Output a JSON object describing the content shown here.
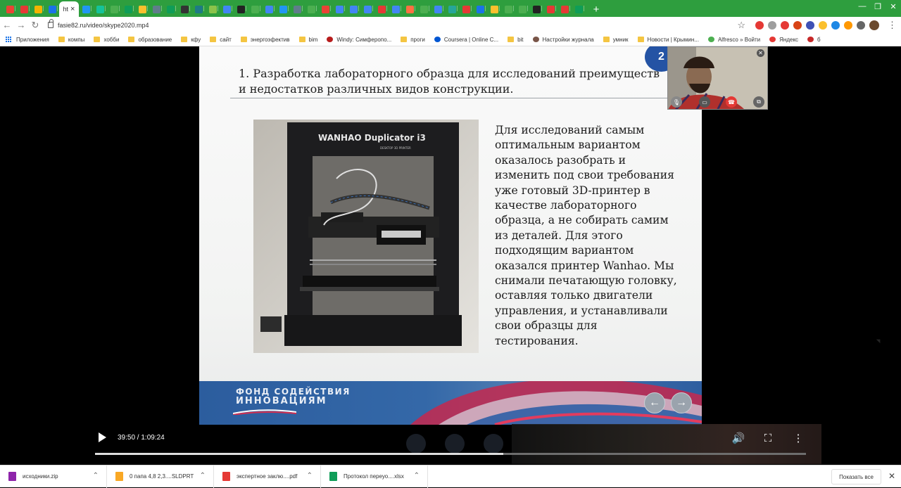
{
  "tabs": [
    {
      "icon": "gmail-icon",
      "color": "#ea4335"
    },
    {
      "icon": "pdf-icon",
      "color": "#e53935",
      "label": "F"
    },
    {
      "icon": "docs-icon",
      "color": "#f4b400"
    },
    {
      "icon": "mail-icon",
      "color": "#1a73e8"
    },
    {
      "icon": "active-tab-icon",
      "color": "#4caf50",
      "active": true,
      "label": "ht"
    },
    {
      "icon": "chat-icon",
      "color": "#2196f3"
    },
    {
      "icon": "grammarly-icon",
      "color": "#15c39a"
    },
    {
      "icon": "feather-icon",
      "color": "#4caf50"
    },
    {
      "icon": "sheet-icon",
      "color": "#0f9d58"
    },
    {
      "icon": "smiley-icon",
      "color": "#fbc02d"
    },
    {
      "icon": "card-icon",
      "color": "#607d8b"
    },
    {
      "icon": "sheet-icon-2",
      "color": "#0f9d58",
      "label": "E"
    },
    {
      "icon": "pkp-icon",
      "color": "#333333",
      "label": "PKP"
    },
    {
      "icon": "scribd-icon",
      "color": "#1e7b85"
    },
    {
      "icon": "leaf-icon",
      "color": "#8bc34a"
    },
    {
      "icon": "google-icon",
      "color": "#4285f4"
    },
    {
      "icon": "academia-icon",
      "color": "#222222",
      "label": "A"
    },
    {
      "icon": "feather-icon-2",
      "color": "#4caf50"
    },
    {
      "icon": "google-icon-2",
      "color": "#4285f4"
    },
    {
      "icon": "share-icon",
      "color": "#2196f3"
    },
    {
      "icon": "globe-icon",
      "color": "#607d8b"
    },
    {
      "icon": "sync-icon",
      "color": "#4caf50"
    },
    {
      "icon": "maps-icon",
      "color": "#ea4335"
    },
    {
      "icon": "refresh-icon",
      "color": "#4285f4"
    },
    {
      "icon": "google-icon-3",
      "color": "#4285f4"
    },
    {
      "icon": "google-icon-4",
      "color": "#4285f4"
    },
    {
      "icon": "feather-icon-3",
      "color": "#e53935"
    },
    {
      "icon": "google-icon-5",
      "color": "#4285f4"
    },
    {
      "icon": "orange-icon",
      "color": "#ff7043"
    },
    {
      "icon": "phone-icon",
      "color": "#4caf50"
    },
    {
      "icon": "google-icon-6",
      "color": "#4285f4"
    },
    {
      "icon": "edge-icon",
      "color": "#26a69a"
    },
    {
      "icon": "feather-icon-4",
      "color": "#e53935"
    },
    {
      "icon": "mail-icon-2",
      "color": "#1a73e8"
    },
    {
      "icon": "chrome-icon",
      "color": "#fbc02d"
    },
    {
      "icon": "pen-icon",
      "color": "#4caf50"
    },
    {
      "icon": "pen-icon-2",
      "color": "#4caf50"
    },
    {
      "icon": "academia-icon-2",
      "color": "#222222",
      "label": "A"
    },
    {
      "icon": "feather-icon-5",
      "color": "#e53935"
    },
    {
      "icon": "bug-icon",
      "color": "#e53935"
    },
    {
      "icon": "sheet-icon-3",
      "color": "#0f9d58"
    }
  ],
  "new_tab_label": "+",
  "address": {
    "url": "fasie82.ru/video/skype2020.mp4"
  },
  "bookmarks": [
    {
      "label": "Приложения",
      "kind": "apps"
    },
    {
      "label": "компы",
      "kind": "folder"
    },
    {
      "label": "хобби",
      "kind": "folder"
    },
    {
      "label": "образование",
      "kind": "folder"
    },
    {
      "label": "кфу",
      "kind": "folder"
    },
    {
      "label": "сайт",
      "kind": "folder"
    },
    {
      "label": "энергоэфектив",
      "kind": "folder"
    },
    {
      "label": "bim",
      "kind": "folder"
    },
    {
      "label": "Windy: Симферопо...",
      "kind": "windy"
    },
    {
      "label": "проги",
      "kind": "folder"
    },
    {
      "label": "Coursera | Online C...",
      "kind": "coursera"
    },
    {
      "label": "bit",
      "kind": "folder"
    },
    {
      "label": "Настройки журнала",
      "kind": "journal"
    },
    {
      "label": "умник",
      "kind": "folder"
    },
    {
      "label": "Новости | Крымин...",
      "kind": "folder"
    },
    {
      "label": "Alfresco » Войти",
      "kind": "alfresco"
    },
    {
      "label": "Яндекс",
      "kind": "yandex"
    },
    {
      "label": "б",
      "kind": "other"
    }
  ],
  "slide": {
    "number": "2",
    "title": "1. Разработка лабораторного образца для исследований преимуществ и недостатков различных видов конструкции.",
    "photo_caption": "WANHAO Duplicator i3",
    "photo_sub": "DESKTOP 3D PRINTER",
    "body": "Для исследований самым оптимальным вариантом оказалось разобрать и изменить под свои требования уже готовый 3D-принтер в качестве лабораторного образца, а не собирать самим из деталей. Для этого подходящим вариантом оказался принтер Wanhao. Мы снимали печатающую головку, оставляя только двигатели управления, и устанавливали свои образцы для тестирования.",
    "footer_logo_line1": "ФОНД СОДЕЙСТВИЯ",
    "footer_logo_line2": "ИННОВАЦИЯМ"
  },
  "player": {
    "current_time": "39:50",
    "duration": "1:09:24",
    "time_display": "39:50 / 1:09:24",
    "progress_fraction": 0.574
  },
  "downloads": [
    {
      "name": "исходники.zip",
      "color": "#8e24aa"
    },
    {
      "name": "0 папа 4,8 2,3....SLDPRT",
      "color": "#f9a825"
    },
    {
      "name": "экспертное заклю....pdf",
      "color": "#e53935"
    },
    {
      "name": "Протокол переуо....xlsx",
      "color": "#0f9d58"
    }
  ],
  "show_all_label": "Показать все"
}
